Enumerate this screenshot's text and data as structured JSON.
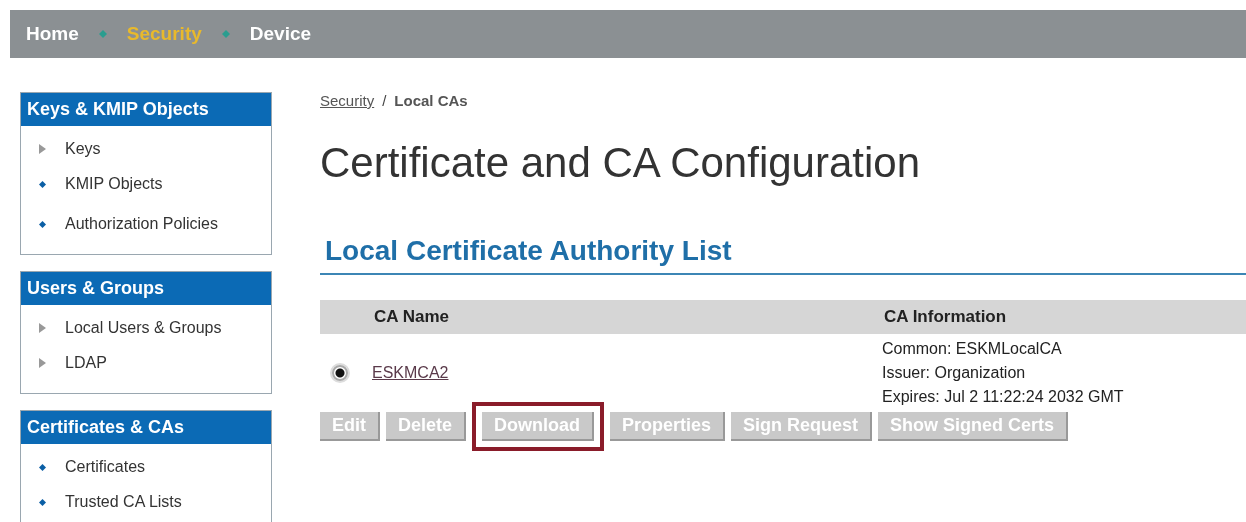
{
  "nav": [
    {
      "label": "Home",
      "selected": false
    },
    {
      "label": "Security",
      "selected": true
    },
    {
      "label": "Device",
      "selected": false
    }
  ],
  "sidebar": [
    {
      "title": "Keys & KMIP Objects",
      "items": [
        {
          "label": "Keys",
          "kind": "arrow"
        },
        {
          "label": "KMIP Objects",
          "kind": "dot"
        },
        {
          "label": "Authorization Policies",
          "kind": "dot"
        }
      ]
    },
    {
      "title": "Users & Groups",
      "items": [
        {
          "label": "Local Users & Groups",
          "kind": "arrow"
        },
        {
          "label": "LDAP",
          "kind": "arrow"
        }
      ]
    },
    {
      "title": "Certificates & CAs",
      "items": [
        {
          "label": "Certificates",
          "kind": "dot"
        },
        {
          "label": "Trusted CA Lists",
          "kind": "dot"
        }
      ]
    }
  ],
  "breadcrumb": {
    "link": "Security",
    "separator": "/",
    "current": "Local CAs"
  },
  "page_title": "Certificate and CA Configuration",
  "section_title": "Local Certificate Authority List",
  "table": {
    "columns": [
      "CA Name",
      "CA Information"
    ],
    "rows": [
      {
        "selected": true,
        "name": "ESKMCA2",
        "info": [
          "Common: ESKMLocalCA",
          "Issuer: Organization",
          "Expires: Jul  2 11:22:24 2032 GMT"
        ]
      }
    ]
  },
  "buttons": [
    {
      "label": "Edit",
      "highlighted": false
    },
    {
      "label": "Delete",
      "highlighted": false
    },
    {
      "label": "Download",
      "highlighted": true
    },
    {
      "label": "Properties",
      "highlighted": false
    },
    {
      "label": "Sign Request",
      "highlighted": false
    },
    {
      "label": "Show Signed Certs",
      "highlighted": false
    }
  ]
}
